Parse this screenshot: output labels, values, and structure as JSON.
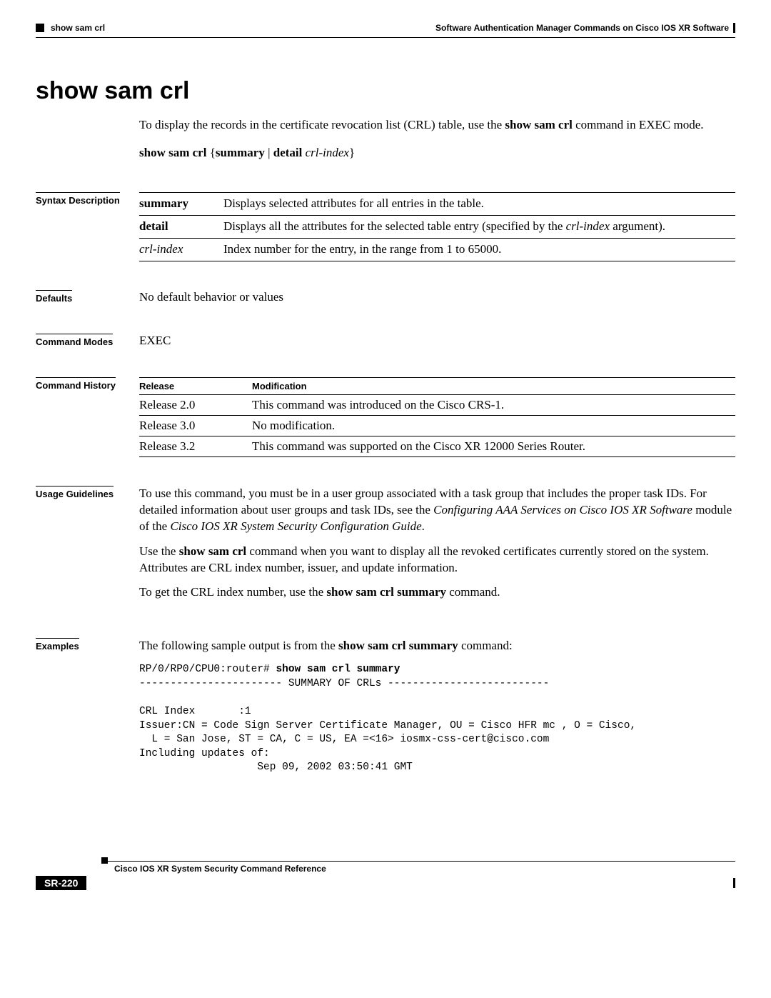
{
  "header": {
    "breadcrumb": "show sam crl",
    "chapter": "Software Authentication Manager Commands on Cisco IOS XR Software"
  },
  "title": "show sam crl",
  "intro": {
    "pre": "To display the records in the certificate revocation list (CRL) table, use the ",
    "bold": "show sam crl",
    "post": " command in EXEC mode."
  },
  "syntax": {
    "cmd": "show sam crl",
    "opts_open": " {",
    "summary": "summary",
    "bar": " | ",
    "detail_kw": "detail",
    "space": " ",
    "arg": "crl-index",
    "opts_close": "}"
  },
  "sections": {
    "syntax_desc_label": "Syntax Description",
    "defaults_label": "Defaults",
    "modes_label": "Command Modes",
    "history_label": "Command History",
    "usage_label": "Usage Guidelines",
    "examples_label": "Examples"
  },
  "syntax_desc": [
    {
      "kw": "summary",
      "kw_bold": true,
      "kw_italic": false,
      "desc_pre": "Displays selected attributes for all entries in the table.",
      "desc_it": "",
      "desc_post": ""
    },
    {
      "kw": "detail",
      "kw_bold": true,
      "kw_italic": false,
      "desc_pre": "Displays all the attributes for the selected table entry (specified by the ",
      "desc_it": "crl-index",
      "desc_post": " argument)."
    },
    {
      "kw": "crl-index",
      "kw_bold": false,
      "kw_italic": true,
      "desc_pre": "Index number for the entry, in the range from 1 to 65000.",
      "desc_it": "",
      "desc_post": ""
    }
  ],
  "defaults": "No default behavior or values",
  "command_modes": "EXEC",
  "history_headers": {
    "release": "Release",
    "modification": "Modification"
  },
  "history": [
    {
      "release": "Release 2.0",
      "mod": "This command was introduced on the Cisco CRS-1."
    },
    {
      "release": "Release 3.0",
      "mod": "No modification."
    },
    {
      "release": "Release 3.2",
      "mod": "This command was supported on the Cisco XR 12000 Series Router."
    }
  ],
  "usage": {
    "p1_a": "To use this command, you must be in a user group associated with a task group that includes the proper task IDs. For detailed information about user groups and task IDs, see the ",
    "p1_i1": "Configuring AAA Services on Cisco IOS XR Software",
    "p1_b": " module of the ",
    "p1_i2": "Cisco IOS XR System Security Configuration Guide",
    "p1_c": ".",
    "p2_a": "Use the ",
    "p2_bold": "show sam crl",
    "p2_b": " command when you want to display all the revoked certificates currently stored on the system. Attributes are CRL index number, issuer, and update information.",
    "p3_a": "To get the CRL index number, use the ",
    "p3_bold": "show sam crl summary",
    "p3_b": " command."
  },
  "examples": {
    "lead_a": "The following sample output is from the ",
    "lead_bold": "show sam crl summary",
    "lead_b": " command:",
    "prompt": "RP/0/RP0/CPU0:router# ",
    "prompt_cmd": "show sam crl summary",
    "output": "\n----------------------- SUMMARY OF CRLs --------------------------\n\nCRL Index       :1\nIssuer:CN = Code Sign Server Certificate Manager, OU = Cisco HFR mc , O = Cisco,\n  L = San Jose, ST = CA, C = US, EA =<16> iosmx-css-cert@cisco.com\nIncluding updates of:\n                   Sep 09, 2002 03:50:41 GMT"
  },
  "footer": {
    "book": "Cisco IOS XR System Security Command Reference",
    "page": "SR-220"
  }
}
